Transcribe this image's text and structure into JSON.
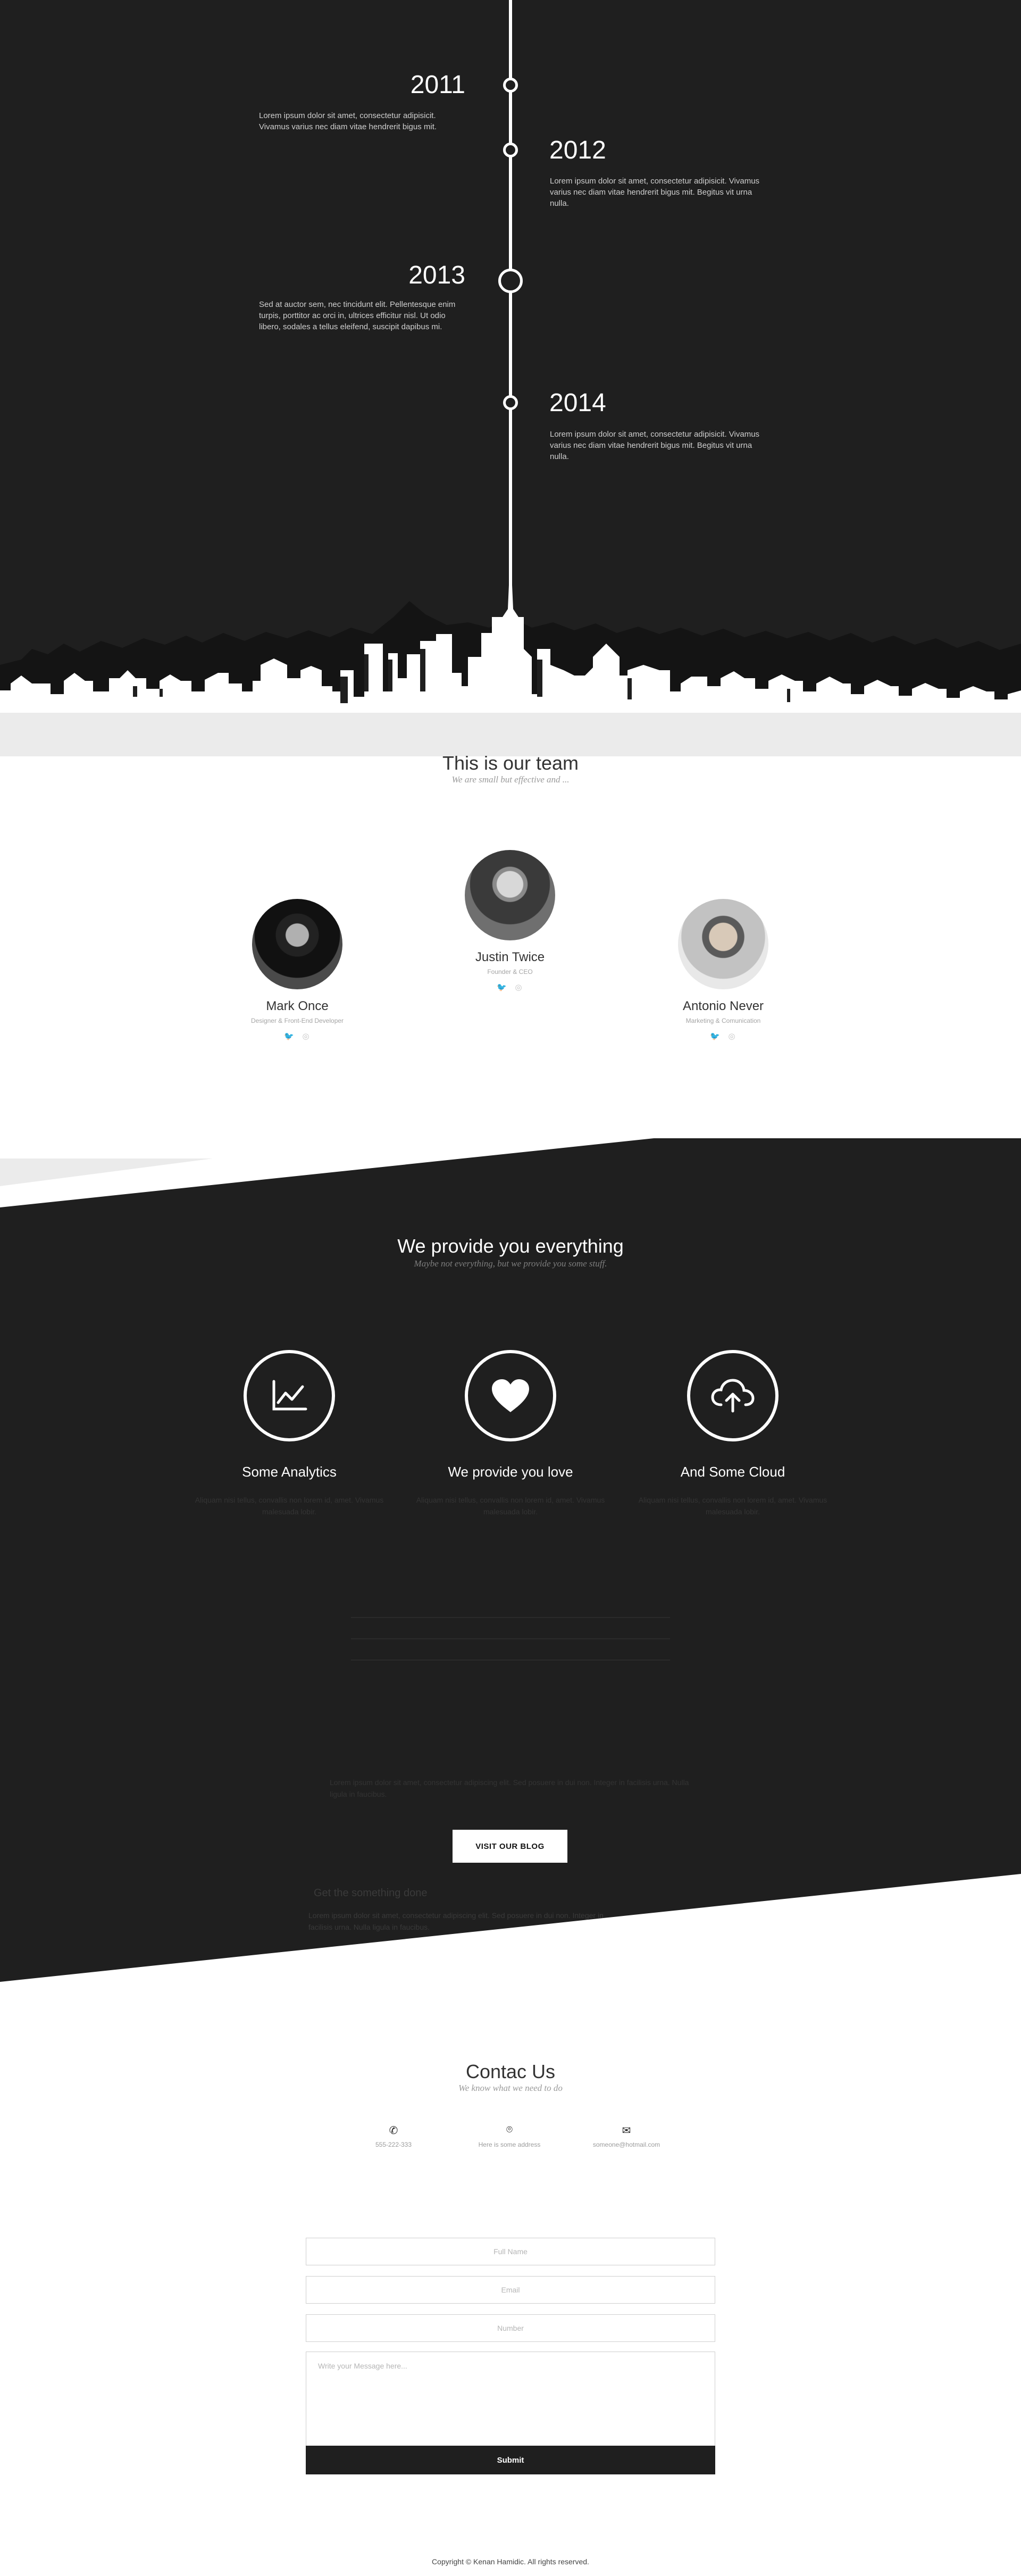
{
  "timeline": {
    "entries": [
      {
        "year": "2011",
        "text": "Lorem ipsum dolor sit amet, consectetur adipisicit. Vivamus varius nec diam vitae hendrerit bigus mit."
      },
      {
        "year": "2012",
        "text": "Lorem ipsum dolor sit amet, consectetur adipisicit. Vivamus varius nec diam vitae hendrerit bigus mit. Begitus vit urna nulla."
      },
      {
        "year": "2013",
        "text": "Sed at auctor sem, nec tincidunt elit. Pellentesque enim turpis, porttitor ac orci in, ultrices efficitur nisl. Ut odio libero, sodales a tellus eleifend, suscipit dapibus mi."
      },
      {
        "year": "2014",
        "text": "Lorem ipsum dolor sit amet, consectetur adipisicit. Vivamus varius nec diam vitae hendrerit bigus mit. Begitus vit urna nulla."
      }
    ]
  },
  "team": {
    "title": "This is our team",
    "subtitle": "We are small but effective and ...",
    "members": [
      {
        "name": "Mark Once",
        "role": "Designer & Front-End Developer"
      },
      {
        "name": "Justin Twice",
        "role": "Founder & CEO"
      },
      {
        "name": "Antonio Never",
        "role": "Marketing & Comunication"
      }
    ]
  },
  "services": {
    "title": "We provide you everything",
    "subtitle": "Maybe not everything, but we provide you some stuff.",
    "features": [
      {
        "name": "Some Analytics",
        "icon": "chart-icon",
        "desc": "Aliquam nisi tellus, convallis non lorem id, amet. Vivamus malesuada lobir."
      },
      {
        "name": "We provide you love",
        "icon": "heart-icon",
        "desc": "Aliquam nisi tellus, convallis non lorem id, amet. Vivamus malesuada lobir."
      },
      {
        "name": "And Some Cloud",
        "icon": "cloud-upload-icon",
        "desc": "Aliquam nisi tellus, convallis non lorem id, amet. Vivamus malesuada lobir."
      }
    ],
    "blog_post_text": "Lorem ipsum dolor sit amet, consectetur adipiscing elit. Sed posuere in dui non. Integer in facilisis urna. Nulla ligula in faucibus.",
    "blog_post_title": "Get the something done",
    "blog_button": "Visit our blog"
  },
  "contact": {
    "title": "Contac Us",
    "subtitle": "We know what we need to do",
    "phone": "555-222-333",
    "address": "Here is some address",
    "email": "someone@hotmail.com",
    "fields": {
      "full_name": "Full Name",
      "email": "Email",
      "number": "Number",
      "message": "Write your Message here..."
    },
    "submit": "Submit"
  },
  "footer": {
    "copyright": "Copyright © Kenan Hamidic. All rights reserved."
  }
}
